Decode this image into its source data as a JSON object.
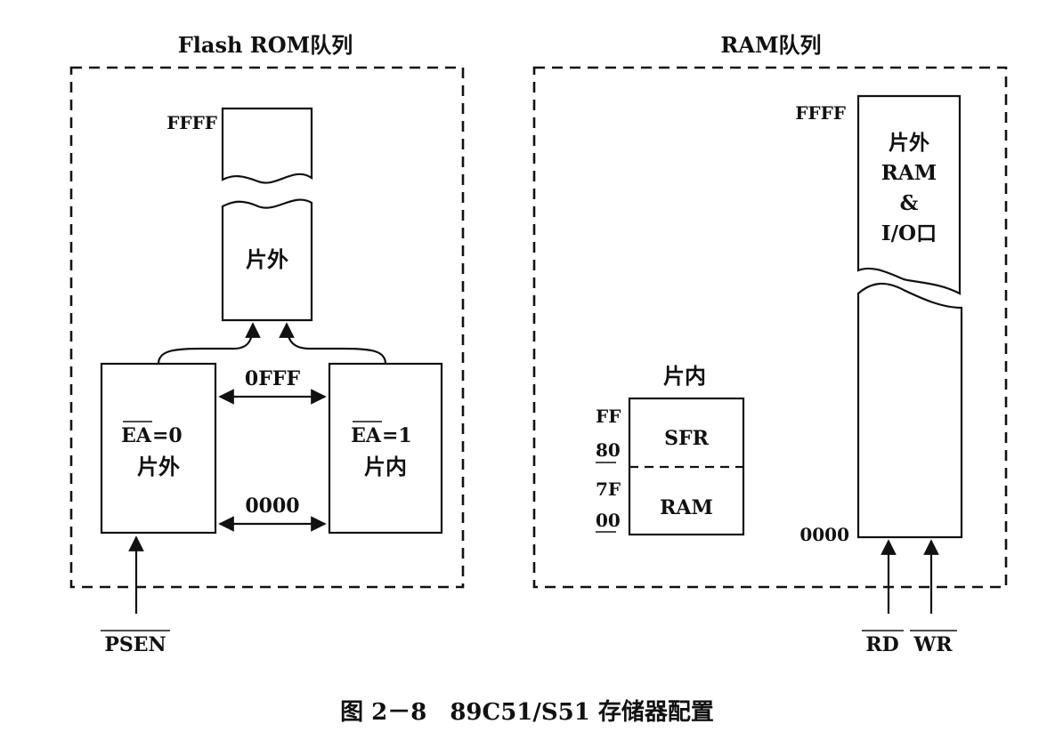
{
  "left_panel": {
    "title": "Flash ROM队列",
    "top_addr": "FFFF",
    "offchip_label": "片外",
    "mid_addr": "0FFF",
    "low_addr": "0000",
    "ea0": {
      "signal": "EA",
      "value": "=0",
      "label": "片外"
    },
    "ea1": {
      "signal": "EA",
      "value": "=1",
      "label": "片内"
    },
    "input_signal": "PSEN"
  },
  "right_panel": {
    "title": "RAM队列",
    "top_addr": "FFFF",
    "bottom_addr": "0000",
    "ext_lines": [
      "片外",
      "RAM",
      "&",
      "I/O口"
    ],
    "internal": {
      "title": "片内",
      "addr_ff": "FF",
      "addr_80": "80",
      "addr_7f": "7F",
      "addr_00": "00",
      "sfr_label": "SFR",
      "ram_label": "RAM"
    },
    "signal_rd": "RD",
    "signal_wr": "WR"
  },
  "caption": "图 2－8　89C51/S51 存储器配置"
}
